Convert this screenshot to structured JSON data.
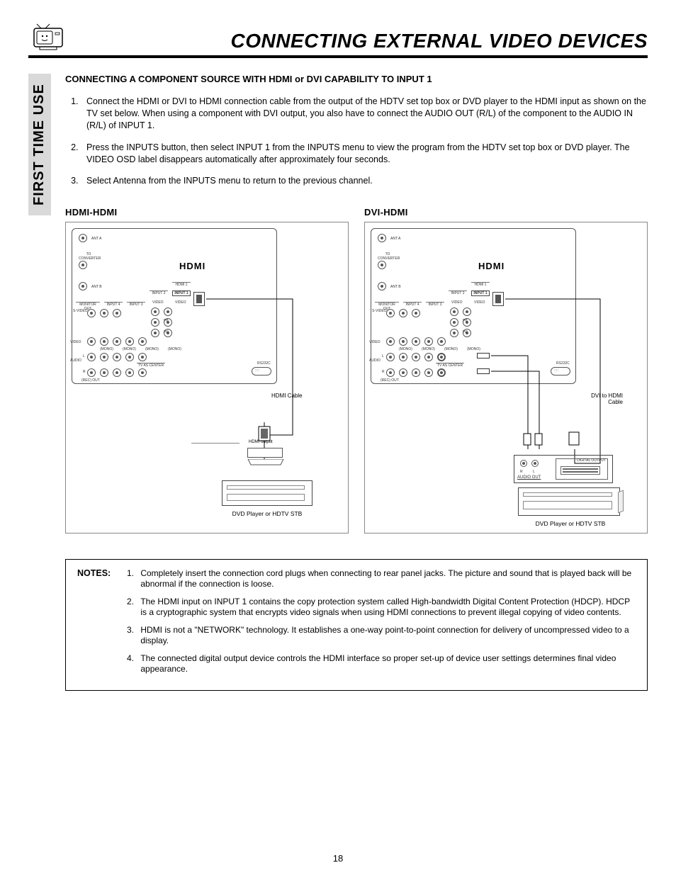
{
  "header": {
    "title": "CONNECTING EXTERNAL VIDEO DEVICES"
  },
  "side_tab": "FIRST TIME USE",
  "section_title": "CONNECTING A COMPONENT SOURCE WITH HDMI or DVI CAPABILITY TO INPUT 1",
  "steps": [
    "Connect the HDMI or DVI to HDMI connection cable from the output of the HDTV set top box or DVD player to the HDMI input as shown on the TV set below.  When using a component with DVI output, you also have to connect the AUDIO OUT (R/L) of the component to the AUDIO IN (R/L) of INPUT 1.",
    "Press the INPUTS button, then select INPUT 1 from the INPUTS menu to view the program from the HDTV set top box or DVD player.  The VIDEO OSD label disappears automatically after approximately four seconds.",
    "Select Antenna from the INPUTS menu to return to the previous channel."
  ],
  "diagrams": {
    "left": {
      "label": "HDMI-HDMI",
      "hdmi_logo": "HDMI",
      "labels": {
        "ant_a": "ANT A",
        "to_converter": "TO CONVERTER",
        "ant_b": "ANT B",
        "monitor_out": "MONITOR OUT",
        "svideo": "S-VIDEO",
        "video": "VIDEO",
        "audio": "AUDIO",
        "audio_sub": "(REC) OUT",
        "mono": "(MONO)",
        "input1": "INPUT 1",
        "input2": "INPUT 2",
        "input3": "INPUT 3",
        "input4": "INPUT 4",
        "hdmi1": "HDMI 1",
        "pb": "PB",
        "pr": "PR",
        "tv_center": "TV AS CENTER",
        "rs232c": "RS232C",
        "l": "L",
        "r": "R"
      },
      "cable": "HDMI Cable",
      "hdmi_output": "HDMI output",
      "device": "DVD Player or HDTV STB"
    },
    "right": {
      "label": "DVI-HDMI",
      "hdmi_logo": "HDMI",
      "labels": {
        "ant_a": "ANT A",
        "to_converter": "TO CONVERTER",
        "ant_b": "ANT B",
        "monitor_out": "MONITOR OUT",
        "svideo": "S-VIDEO",
        "video": "VIDEO",
        "audio": "AUDIO",
        "audio_sub": "(REC) OUT",
        "mono": "(MONO)",
        "input1": "INPUT 1",
        "input2": "INPUT 2",
        "input3": "INPUT 3",
        "input4": "INPUT 4",
        "hdmi1": "HDMI 1",
        "pb": "PB",
        "pr": "PR",
        "tv_center": "TV AS CENTER",
        "rs232c": "RS232C",
        "l": "L",
        "r": "R",
        "audio_r": "R",
        "audio_l": "L",
        "audio_out": "AUDIO OUT",
        "digital_output": "DIGITAL OUTPUT"
      },
      "cable": "DVI to HDMI Cable",
      "device": "DVD Player or HDTV STB"
    }
  },
  "notes": {
    "header": "NOTES:",
    "items": [
      "Completely insert the connection cord plugs when connecting to rear panel jacks.  The picture and sound that is played back will be abnormal if the connection is loose.",
      "The HDMI input on INPUT 1 contains the copy protection system called High-bandwidth Digital Content Protection (HDCP).  HDCP is a cryptographic system that encrypts video signals when using HDMI connections to prevent illegal copying of video contents.",
      "HDMI is not a \"NETWORK\" technology.  It establishes a one-way point-to-point connection for delivery of uncompressed video to a display.",
      "The connected digital output device controls the HDMI interface so proper set-up of device user settings determines final video appearance."
    ]
  },
  "page_number": "18"
}
